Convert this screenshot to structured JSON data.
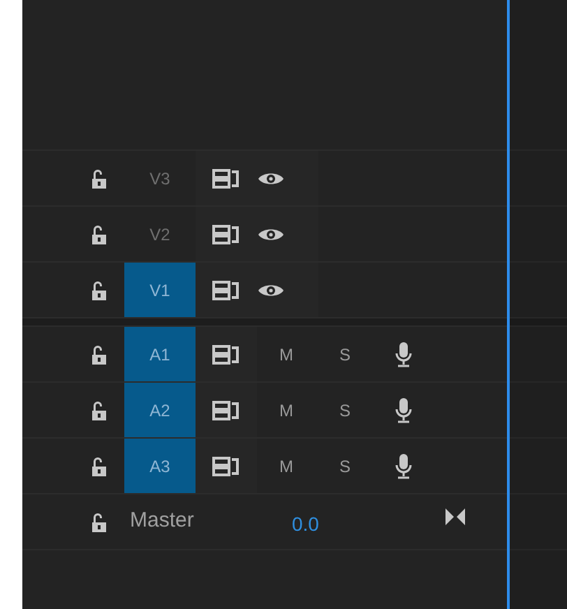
{
  "video_tracks": [
    {
      "name": "V3",
      "targeted": false
    },
    {
      "name": "V2",
      "targeted": false
    },
    {
      "name": "V1",
      "targeted": true
    }
  ],
  "audio_tracks": [
    {
      "name": "A1",
      "targeted": true,
      "mute": "M",
      "solo": "S"
    },
    {
      "name": "A2",
      "targeted": true,
      "mute": "M",
      "solo": "S"
    },
    {
      "name": "A3",
      "targeted": true,
      "mute": "M",
      "solo": "S"
    }
  ],
  "master": {
    "label": "Master",
    "value": "0.0"
  }
}
